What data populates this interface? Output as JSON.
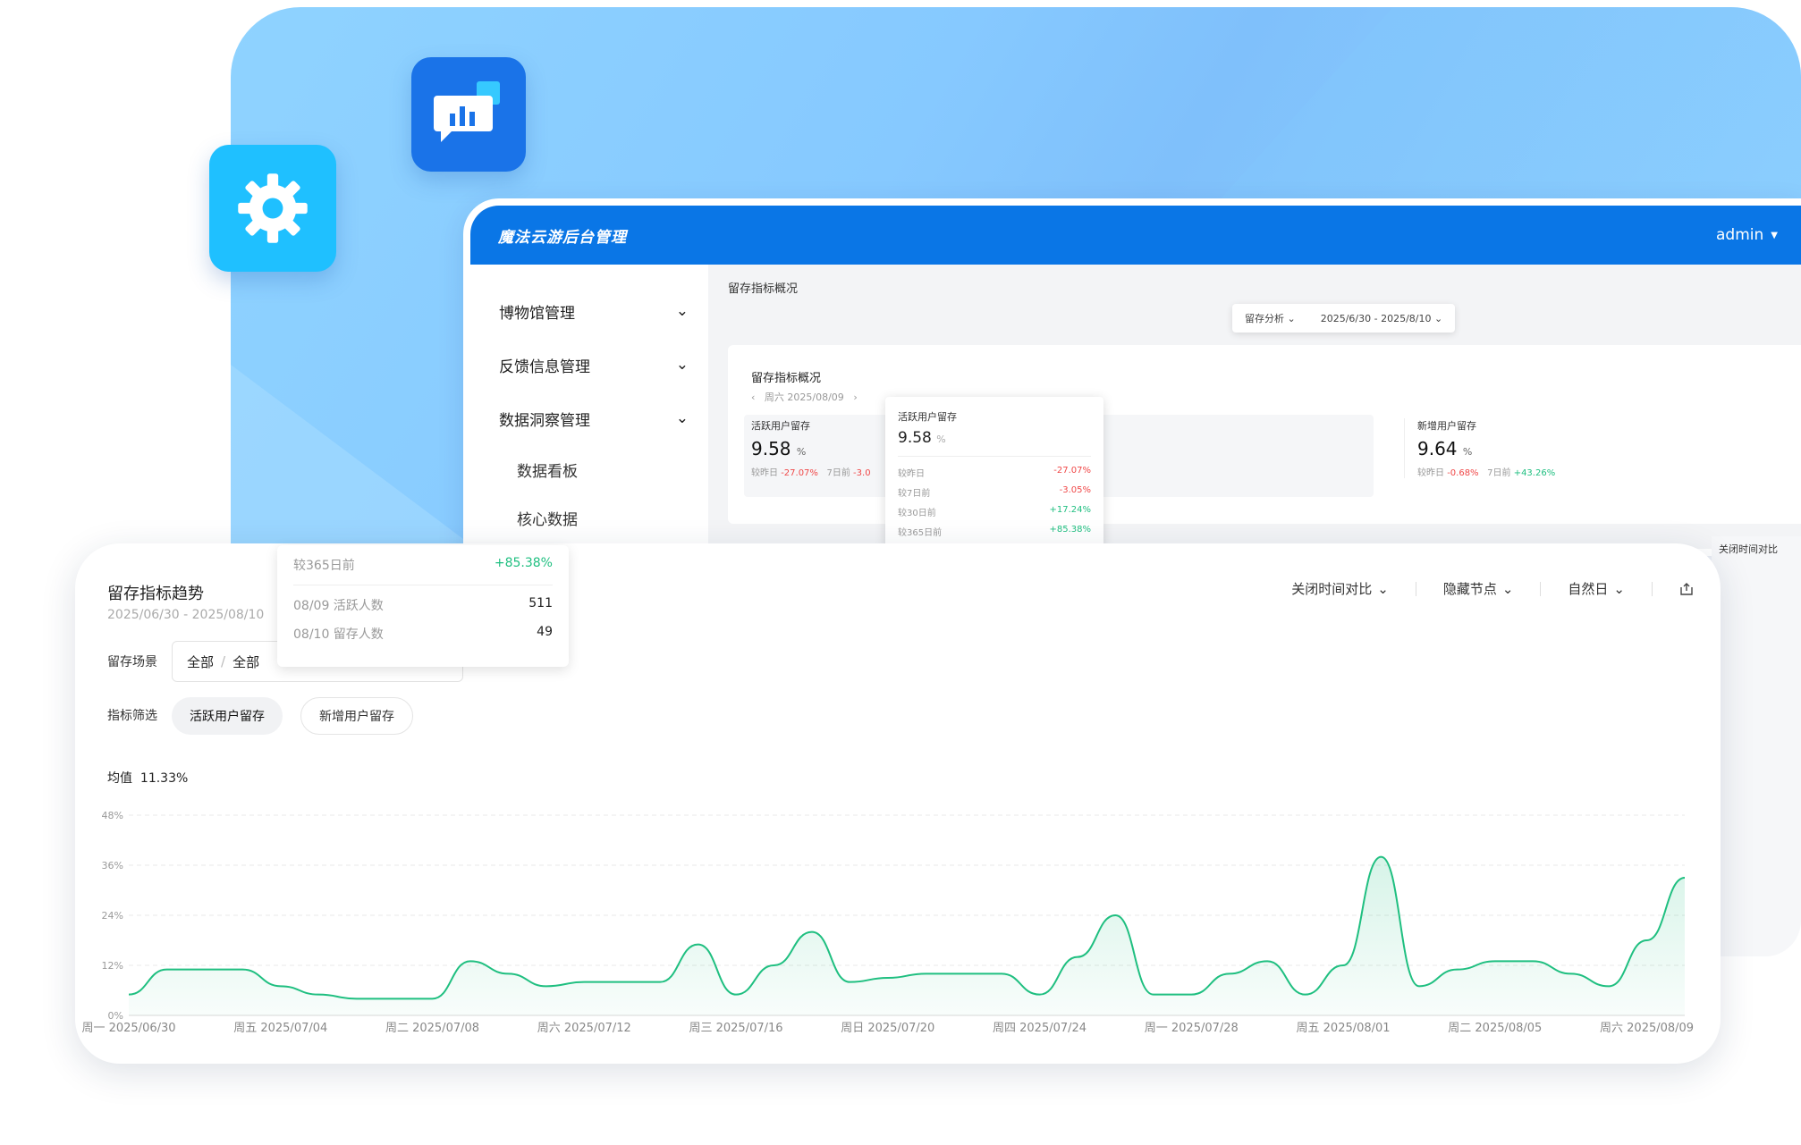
{
  "admin": {
    "title": "魔法云游后台管理",
    "user": "admin",
    "sidebar": [
      {
        "label": "博物馆管理"
      },
      {
        "label": "反馈信息管理"
      },
      {
        "label": "数据洞察管理"
      }
    ],
    "sub_items": [
      "数据看板",
      "核心数据"
    ],
    "main_title": "留存指标概况",
    "filter": {
      "analysis": "留存分析",
      "range": "2025/6/30 - 2025/8/10"
    },
    "panel": {
      "title": "留存指标概况",
      "date": "周六 2025/08/09",
      "active": {
        "label": "活跃用户留存",
        "value": "9.58",
        "unit": "%",
        "cmp_day_label": "较昨日",
        "cmp_day": "-27.07%",
        "cmp_week_label": "7日前",
        "cmp_week": "-3.0"
      },
      "new": {
        "label": "新增用户留存",
        "value": "9.64",
        "unit": "%",
        "cmp_day_label": "较昨日",
        "cmp_day": "-0.68%",
        "cmp_week_label": "7日前",
        "cmp_week": "+43.26%"
      }
    },
    "tooltip": {
      "label": "活跃用户留存",
      "value": "9.58",
      "unit": "%",
      "rows": [
        {
          "k": "较昨日",
          "v": "-27.07%"
        },
        {
          "k": "较7日前",
          "v": "-3.05%"
        },
        {
          "k": "较30日前",
          "v": "+17.24%"
        },
        {
          "k": "较365日前",
          "v": "+85.38%"
        }
      ]
    },
    "ghost_compare": "关闭时间对比"
  },
  "front": {
    "title": "留存指标趋势",
    "date": "2025/06/30 - 2025/08/10",
    "scene_label": "留存场景",
    "scene_value1": "全部",
    "scene_value2": "全部",
    "indicator_label": "指标筛选",
    "chip_active": "活跃用户留存",
    "chip_plain": "新增用户留存",
    "tools": {
      "compare": "关闭时间对比",
      "hide": "隐藏节点",
      "natural": "自然日"
    },
    "avg_label": "均值",
    "avg_value": "11.33%",
    "tooltip": {
      "row1_k": "较365日前",
      "row1_v": "+85.38%",
      "row2_k": "08/09 活跃人数",
      "row2_v": "511",
      "row3_k": "08/10 留存人数",
      "row3_v": "49"
    }
  },
  "colors": {
    "primary": "#0a76e6",
    "line": "#1fbf80",
    "red": "#f04848",
    "green": "#1fbf80"
  },
  "chart_data": {
    "type": "area",
    "title": "留存指标趋势",
    "ylim": [
      0,
      48
    ],
    "yticks": [
      "0%",
      "12%",
      "24%",
      "36%",
      "48%"
    ],
    "xticks": [
      "周一 2025/06/30",
      "周五 2025/07/04",
      "周二 2025/07/08",
      "周六 2025/07/12",
      "周三 2025/07/16",
      "周日 2025/07/20",
      "周四 2025/07/24",
      "周一 2025/07/28",
      "周五 2025/08/01",
      "周二 2025/08/05",
      "周六 2025/08/09"
    ],
    "x": [
      "06/30",
      "07/01",
      "07/02",
      "07/03",
      "07/04",
      "07/05",
      "07/06",
      "07/07",
      "07/08",
      "07/09",
      "07/10",
      "07/11",
      "07/12",
      "07/13",
      "07/14",
      "07/15",
      "07/16",
      "07/17",
      "07/18",
      "07/19",
      "07/20",
      "07/21",
      "07/22",
      "07/23",
      "07/24",
      "07/25",
      "07/26",
      "07/27",
      "07/28",
      "07/29",
      "07/30",
      "07/31",
      "08/01",
      "08/02",
      "08/03",
      "08/04",
      "08/05",
      "08/06",
      "08/07",
      "08/08",
      "08/09",
      "08/10"
    ],
    "series": [
      {
        "values": [
          5,
          11,
          11,
          11,
          7,
          5,
          4,
          4,
          4,
          13,
          10,
          7,
          8,
          8,
          8,
          17,
          5,
          12,
          20,
          8,
          9,
          10,
          10,
          10,
          5,
          14,
          24,
          5,
          5,
          10,
          13,
          5,
          12,
          38,
          7,
          11,
          13,
          13,
          10,
          7,
          18,
          33
        ]
      }
    ],
    "grid": true
  }
}
